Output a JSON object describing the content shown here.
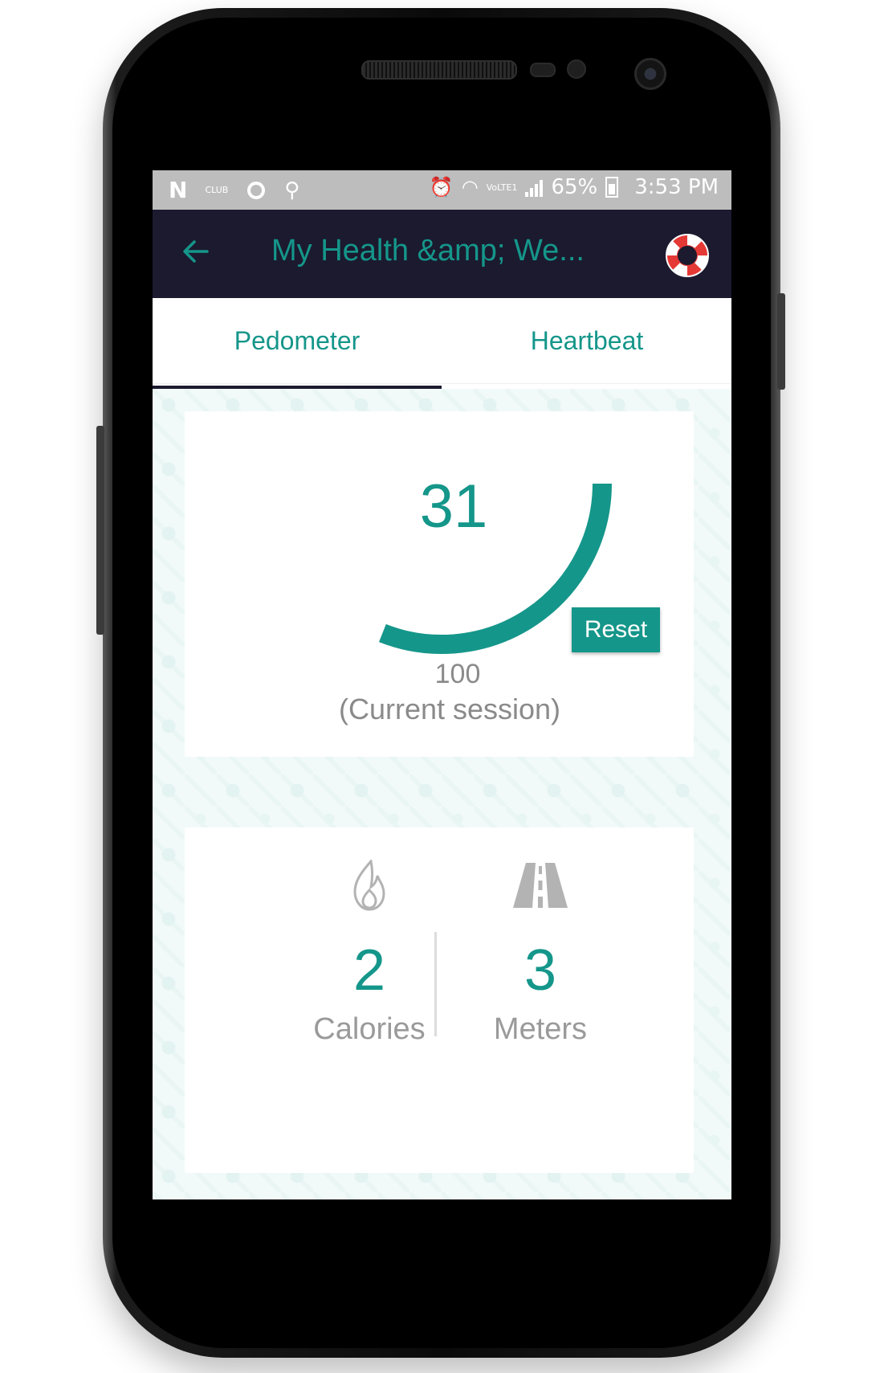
{
  "status_bar": {
    "battery_percent": "65%",
    "time": "3:53 PM",
    "club_text": "CLUB",
    "volte_text": "VoLTE1",
    "icons": [
      "n-icon",
      "club-icon",
      "g-icon",
      "usb-icon",
      "alarm-icon",
      "wifi-icon",
      "volte-icon",
      "signal-icon",
      "battery-icon"
    ]
  },
  "toolbar": {
    "title": "My Health &amp; We...",
    "back_icon": "arrow-left-icon",
    "help_icon": "lifebuoy-icon"
  },
  "tabs": [
    {
      "label": "Pedometer",
      "selected": true
    },
    {
      "label": "Heartbeat",
      "selected": false
    }
  ],
  "pedometer": {
    "steps": "31",
    "goal": "100",
    "session_label": "(Current session)",
    "progress_fraction": 0.31,
    "reset_label": "Reset"
  },
  "stats": {
    "calories": {
      "value": "2",
      "label": "Calories",
      "icon": "flame-icon"
    },
    "meters": {
      "value": "3",
      "label": "Meters",
      "icon": "road-icon"
    }
  },
  "colors": {
    "accent": "#15968a",
    "toolbar_bg": "#1b1a2f",
    "status_bar_bg": "#bdbdbd",
    "muted_text": "#8a8a8a"
  }
}
